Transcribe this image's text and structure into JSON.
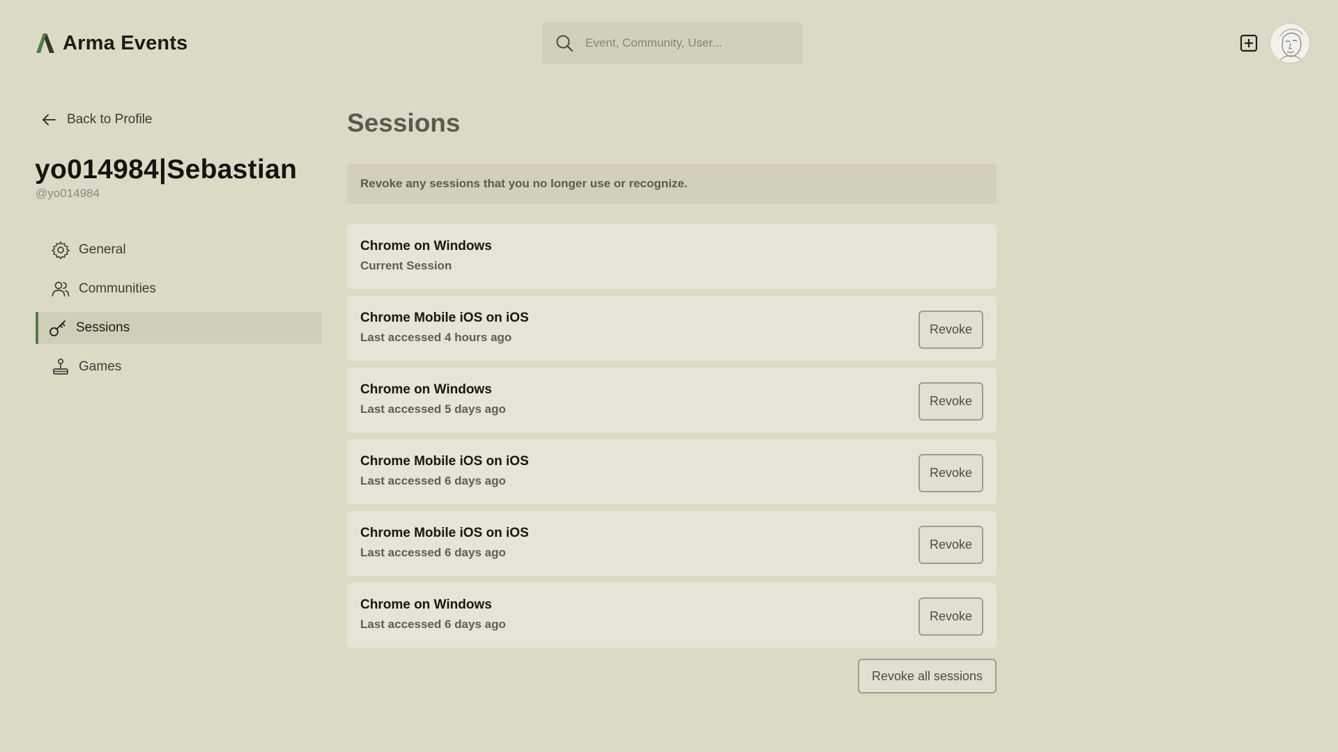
{
  "header": {
    "brand": "Arma Events",
    "search_placeholder": "Event, Community, User...",
    "brand_color": "#4e7d4a"
  },
  "sidebar": {
    "back_label": "Back to Profile",
    "display_name": "yo014984|Sebastian",
    "handle": "@yo014984",
    "items": [
      {
        "label": "General",
        "icon": "gear-icon",
        "active": false
      },
      {
        "label": "Communities",
        "icon": "users-icon",
        "active": false
      },
      {
        "label": "Sessions",
        "icon": "key-icon",
        "active": true
      },
      {
        "label": "Games",
        "icon": "joystick-icon",
        "active": false
      }
    ]
  },
  "main": {
    "title": "Sessions",
    "notice": "Revoke any sessions that you no longer use or recognize.",
    "revoke_label": "Revoke",
    "revoke_all_label": "Revoke all sessions",
    "sessions": [
      {
        "name": "Chrome on Windows",
        "meta": "Current Session"
      },
      {
        "name": "Chrome Mobile iOS on iOS",
        "meta": "Last accessed 4 hours ago"
      },
      {
        "name": "Chrome on Windows",
        "meta": "Last accessed 5 days ago"
      },
      {
        "name": "Chrome Mobile iOS on iOS",
        "meta": "Last accessed 6 days ago"
      },
      {
        "name": "Chrome Mobile iOS on iOS",
        "meta": "Last accessed 6 days ago"
      },
      {
        "name": "Chrome on Windows",
        "meta": "Last accessed 6 days ago"
      }
    ]
  }
}
